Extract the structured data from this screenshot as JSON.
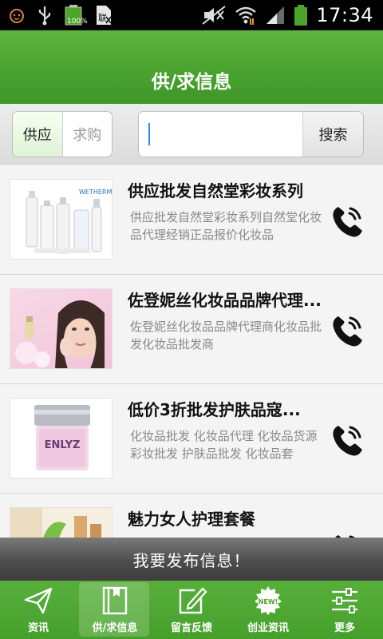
{
  "status_bar": {
    "time": "17:34",
    "battery_percent": "100%",
    "icons": [
      "cat-face-icon",
      "usb-icon",
      "battery-small-icon",
      "sim-icon",
      "mute-icon",
      "wifi-icon",
      "signal-icon",
      "battery-icon"
    ]
  },
  "header": {
    "title": "供/求信息"
  },
  "segment": {
    "supply_label": "供应",
    "demand_label": "求购",
    "selected": "供应"
  },
  "search": {
    "value": "",
    "button_label": "搜索"
  },
  "listings": [
    {
      "title": "供应批发自然堂彩妆系列",
      "description": "供应批发自然堂彩妆系列自然堂化妆品代理经销正品报价化妆品",
      "thumb": "cosmetic-bottles-image"
    },
    {
      "title": "佐登妮丝化妆品品牌代理...",
      "description": "佐登妮丝化妆品品牌代理商化妆品批发化妆品批发商",
      "thumb": "model-face-image"
    },
    {
      "title": "低价3折批发护肤品寇...",
      "description": "化妆品批发 化妆品代理 化妆品货源 彩妆批发 护肤品批发 化妆品套",
      "thumb": "cream-jar-image",
      "thumb_brand": "ENLYZ"
    },
    {
      "title": "魅力女人护理套餐",
      "description": "",
      "thumb": "spa-care-image"
    }
  ],
  "publish_button": {
    "label": "我要发布信息！"
  },
  "bottom_nav": [
    {
      "label": "资讯",
      "icon": "paper-plane-icon"
    },
    {
      "label": "供/求信息",
      "icon": "book-icon",
      "active": true
    },
    {
      "label": "留言反馈",
      "icon": "edit-icon"
    },
    {
      "label": "创业资讯",
      "icon": "new-badge-icon",
      "badge_text": "NEW!"
    },
    {
      "label": "更多",
      "icon": "sliders-icon"
    }
  ],
  "colors": {
    "green": "#4aa32f",
    "dark_bar": "#4d4d4d",
    "search_caret": "#2a8de0"
  }
}
